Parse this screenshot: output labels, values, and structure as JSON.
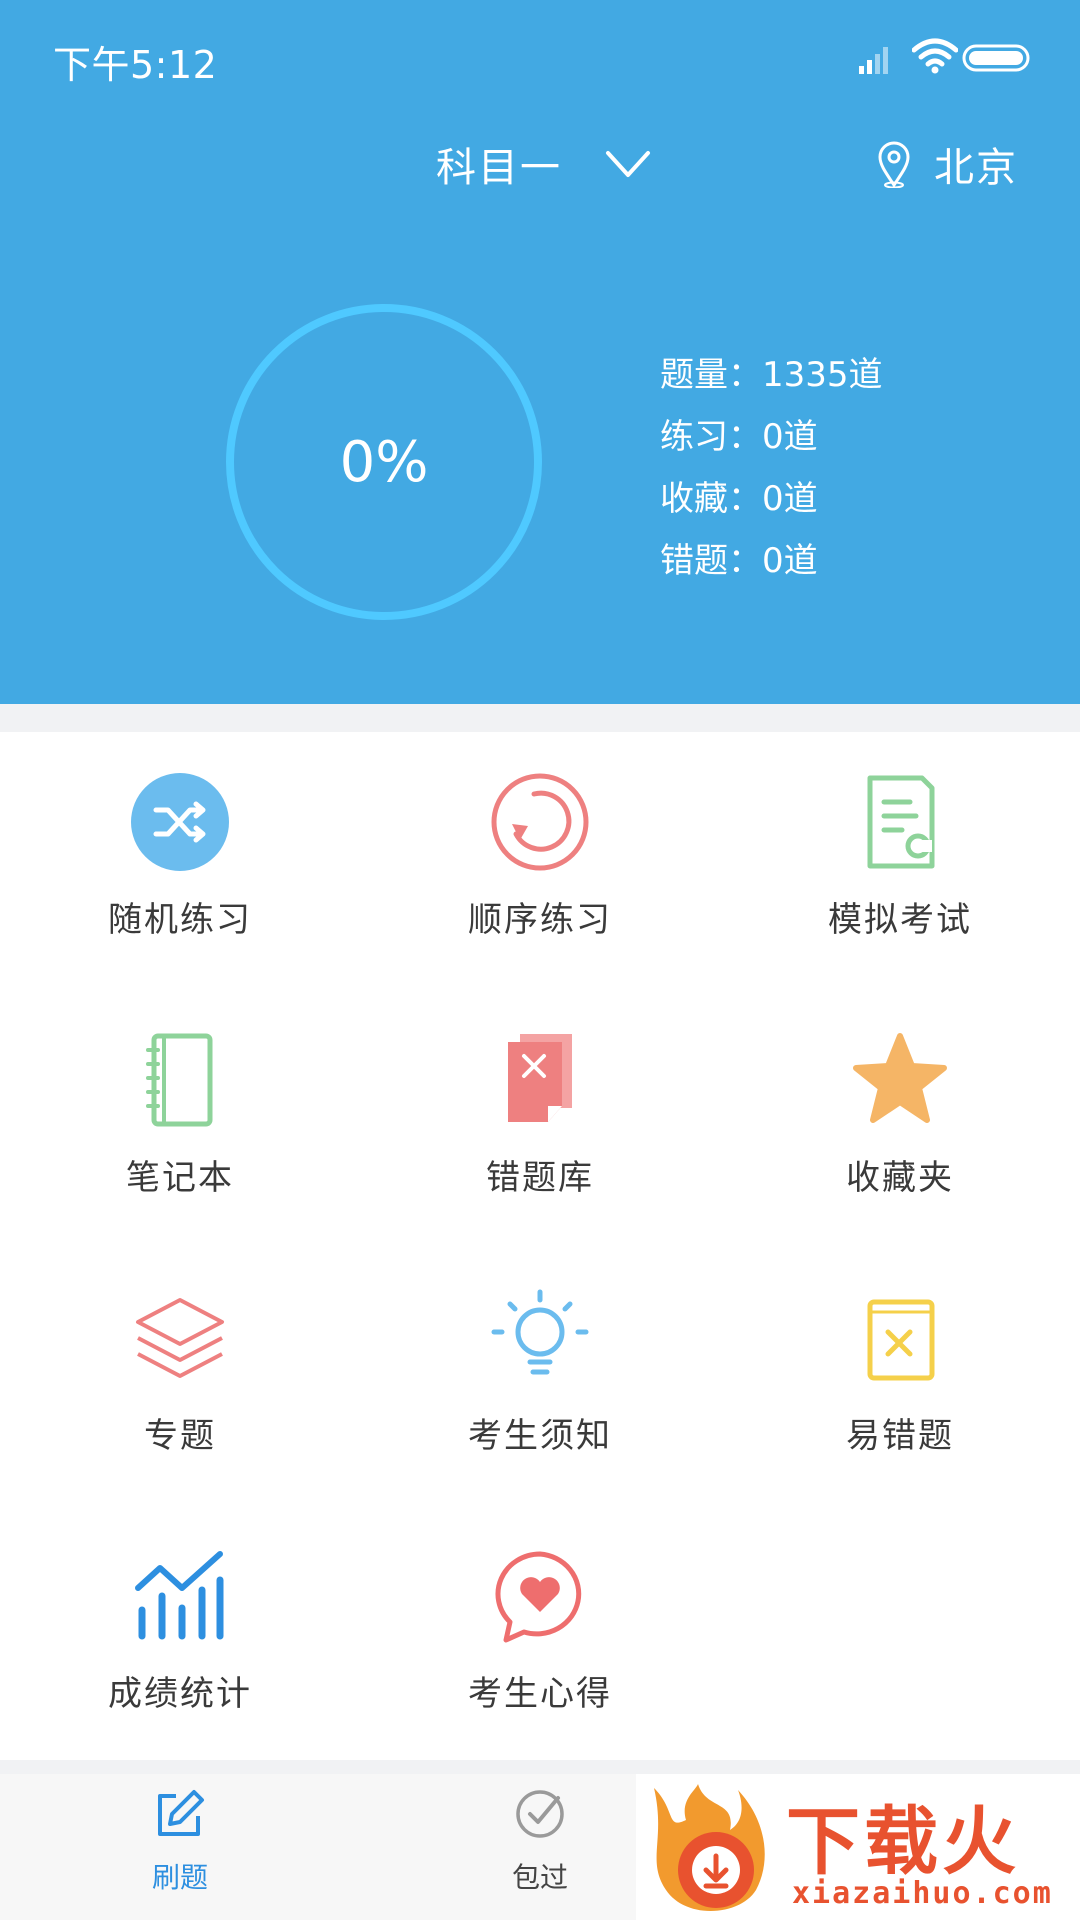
{
  "status_bar": {
    "time": "下午5:12"
  },
  "header": {
    "subject": "科目一",
    "location": "北京",
    "progress": "0%",
    "progress_fraction": 0,
    "stats": [
      {
        "label": "题量",
        "value": "1335道"
      },
      {
        "label": "练习",
        "value": "0道"
      },
      {
        "label": "收藏",
        "value": "0道"
      },
      {
        "label": "错题",
        "value": "0道"
      }
    ]
  },
  "grid": {
    "items": [
      {
        "label": "随机练习",
        "icon": "shuffle-icon"
      },
      {
        "label": "顺序练习",
        "icon": "sequence-icon"
      },
      {
        "label": "模拟考试",
        "icon": "exam-paper-icon"
      },
      {
        "label": "笔记本",
        "icon": "notebook-icon"
      },
      {
        "label": "错题库",
        "icon": "wrong-questions-icon"
      },
      {
        "label": "收藏夹",
        "icon": "star-icon"
      },
      {
        "label": "专题",
        "icon": "layers-icon"
      },
      {
        "label": "考生须知",
        "icon": "lightbulb-icon"
      },
      {
        "label": "易错题",
        "icon": "error-book-icon"
      },
      {
        "label": "成绩统计",
        "icon": "chart-icon"
      },
      {
        "label": "考生心得",
        "icon": "heart-chat-icon"
      }
    ]
  },
  "bottom_nav": {
    "items": [
      {
        "label": "刷题",
        "icon": "edit-icon",
        "active": true
      },
      {
        "label": "包过",
        "icon": "check-circle-icon",
        "active": false
      }
    ]
  },
  "watermark": {
    "title": "下载火",
    "url": "xiazaihuo.com"
  },
  "colors": {
    "header_bg": "#42A9E3",
    "ring": "#4FC9FF",
    "active_nav": "#2D8FE0",
    "watermark": "#E8522F"
  }
}
